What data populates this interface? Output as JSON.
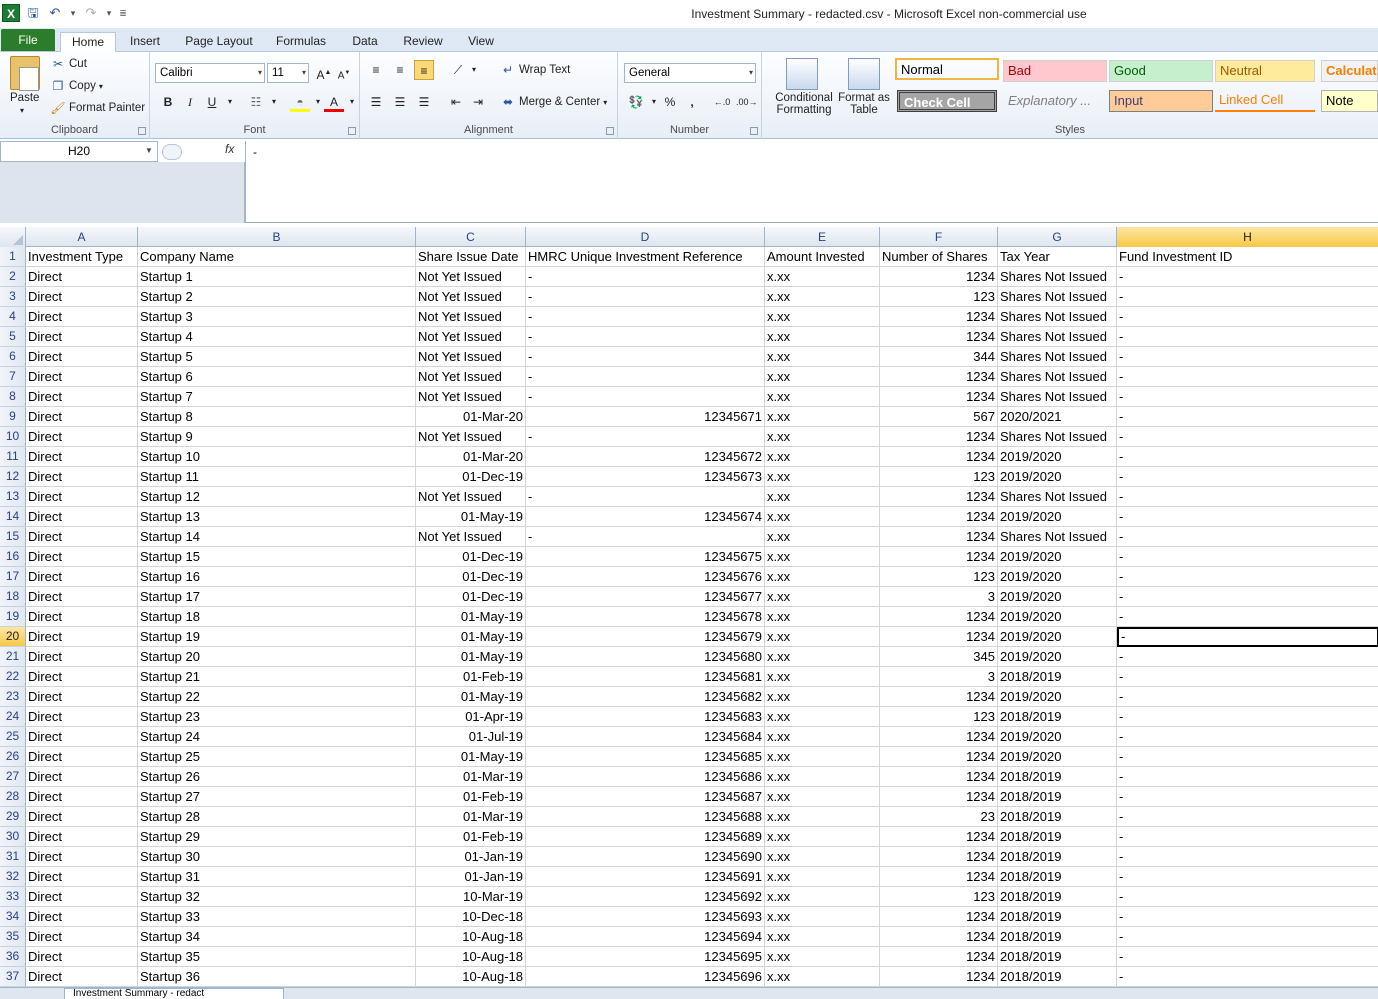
{
  "window": {
    "title": "Investment Summary - redacted.csv  -  Microsoft Excel non-commercial use"
  },
  "qat": {
    "logo": "X"
  },
  "tabs": [
    "File",
    "Home",
    "Insert",
    "Page Layout",
    "Formulas",
    "Data",
    "Review",
    "View"
  ],
  "ribbon": {
    "clipboard": {
      "label": "Clipboard",
      "paste": "Paste",
      "cut": "Cut",
      "copy": "Copy",
      "format_painter": "Format Painter"
    },
    "font": {
      "label": "Font",
      "name": "Calibri",
      "size": "11"
    },
    "alignment": {
      "label": "Alignment",
      "wrap_text": "Wrap Text",
      "merge_center": "Merge & Center"
    },
    "number": {
      "label": "Number",
      "format": "General",
      "percent": "%",
      "comma": ","
    },
    "styles": {
      "label": "Styles",
      "conditional": "Conditional Formatting",
      "format_table": "Format as Table",
      "cells": [
        {
          "name": "Normal",
          "bg": "#ffffff",
          "fg": "#000000"
        },
        {
          "name": "Bad",
          "bg": "#ffc7ce",
          "fg": "#9c0006"
        },
        {
          "name": "Good",
          "bg": "#c6efce",
          "fg": "#006100"
        },
        {
          "name": "Neutral",
          "bg": "#ffeb9c",
          "fg": "#9c5700"
        },
        {
          "name": "Calculati",
          "bg": "#f2f2f2",
          "fg": "#fa7d00"
        },
        {
          "name": "Check Cell",
          "bg": "#a5a5a5",
          "fg": "#ffffff"
        },
        {
          "name": "Explanatory ...",
          "bg": "#ffffff",
          "fg": "#7f7f7f"
        },
        {
          "name": "Input",
          "bg": "#ffcc99",
          "fg": "#3f3f76"
        },
        {
          "name": "Linked Cell",
          "bg": "#ffffff",
          "fg": "#fa7d00"
        },
        {
          "name": "Note",
          "bg": "#ffffcc",
          "fg": "#000000"
        }
      ]
    }
  },
  "formula_bar": {
    "name_box": "H20",
    "fx": "fx",
    "content": "-"
  },
  "columns": [
    "A",
    "B",
    "C",
    "D",
    "E",
    "F",
    "G",
    "H"
  ],
  "selected_column": "H",
  "selected_row": 20,
  "headers": [
    "Investment Type",
    "Company Name",
    "Share Issue Date",
    "HMRC Unique Investment Reference",
    "Amount Invested",
    "Number of Shares",
    "Tax Year",
    "Fund Investment ID"
  ],
  "rows": [
    [
      "Direct",
      "Startup 1",
      "Not Yet Issued",
      "-",
      "x.xx",
      "1234",
      "Shares Not Issued",
      "-"
    ],
    [
      "Direct",
      "Startup 2",
      "Not Yet Issued",
      "-",
      "x.xx",
      "123",
      "Shares Not Issued",
      "-"
    ],
    [
      "Direct",
      "Startup 3",
      "Not Yet Issued",
      "-",
      "x.xx",
      "1234",
      "Shares Not Issued",
      "-"
    ],
    [
      "Direct",
      "Startup 4",
      "Not Yet Issued",
      "-",
      "x.xx",
      "1234",
      "Shares Not Issued",
      "-"
    ],
    [
      "Direct",
      "Startup 5",
      "Not Yet Issued",
      "-",
      "x.xx",
      "344",
      "Shares Not Issued",
      "-"
    ],
    [
      "Direct",
      "Startup 6",
      "Not Yet Issued",
      "-",
      "x.xx",
      "1234",
      "Shares Not Issued",
      "-"
    ],
    [
      "Direct",
      "Startup 7",
      "Not Yet Issued",
      "-",
      "x.xx",
      "1234",
      "Shares Not Issued",
      "-"
    ],
    [
      "Direct",
      "Startup 8",
      "01-Mar-20",
      "12345671",
      "x.xx",
      "567",
      "2020/2021",
      "-"
    ],
    [
      "Direct",
      "Startup 9",
      "Not Yet Issued",
      "-",
      "x.xx",
      "1234",
      "Shares Not Issued",
      "-"
    ],
    [
      "Direct",
      "Startup 10",
      "01-Mar-20",
      "12345672",
      "x.xx",
      "1234",
      "2019/2020",
      "-"
    ],
    [
      "Direct",
      "Startup 11",
      "01-Dec-19",
      "12345673",
      "x.xx",
      "123",
      "2019/2020",
      "-"
    ],
    [
      "Direct",
      "Startup 12",
      "Not Yet Issued",
      "-",
      "x.xx",
      "1234",
      "Shares Not Issued",
      "-"
    ],
    [
      "Direct",
      "Startup 13",
      "01-May-19",
      "12345674",
      "x.xx",
      "1234",
      "2019/2020",
      "-"
    ],
    [
      "Direct",
      "Startup 14",
      "Not Yet Issued",
      "-",
      "x.xx",
      "1234",
      "Shares Not Issued",
      "-"
    ],
    [
      "Direct",
      "Startup 15",
      "01-Dec-19",
      "12345675",
      "x.xx",
      "1234",
      "2019/2020",
      "-"
    ],
    [
      "Direct",
      "Startup 16",
      "01-Dec-19",
      "12345676",
      "x.xx",
      "123",
      "2019/2020",
      "-"
    ],
    [
      "Direct",
      "Startup 17",
      "01-Dec-19",
      "12345677",
      "x.xx",
      "3",
      "2019/2020",
      "-"
    ],
    [
      "Direct",
      "Startup 18",
      "01-May-19",
      "12345678",
      "x.xx",
      "1234",
      "2019/2020",
      "-"
    ],
    [
      "Direct",
      "Startup 19",
      "01-May-19",
      "12345679",
      "x.xx",
      "1234",
      "2019/2020",
      "-"
    ],
    [
      "Direct",
      "Startup 20",
      "01-May-19",
      "12345680",
      "x.xx",
      "345",
      "2019/2020",
      "-"
    ],
    [
      "Direct",
      "Startup 21",
      "01-Feb-19",
      "12345681",
      "x.xx",
      "3",
      "2018/2019",
      "-"
    ],
    [
      "Direct",
      "Startup 22",
      "01-May-19",
      "12345682",
      "x.xx",
      "1234",
      "2019/2020",
      "-"
    ],
    [
      "Direct",
      "Startup 23",
      "01-Apr-19",
      "12345683",
      "x.xx",
      "123",
      "2018/2019",
      "-"
    ],
    [
      "Direct",
      "Startup 24",
      "01-Jul-19",
      "12345684",
      "x.xx",
      "1234",
      "2019/2020",
      "-"
    ],
    [
      "Direct",
      "Startup 25",
      "01-May-19",
      "12345685",
      "x.xx",
      "1234",
      "2019/2020",
      "-"
    ],
    [
      "Direct",
      "Startup 26",
      "01-Mar-19",
      "12345686",
      "x.xx",
      "1234",
      "2018/2019",
      "-"
    ],
    [
      "Direct",
      "Startup 27",
      "01-Feb-19",
      "12345687",
      "x.xx",
      "1234",
      "2018/2019",
      "-"
    ],
    [
      "Direct",
      "Startup 28",
      "01-Mar-19",
      "12345688",
      "x.xx",
      "23",
      "2018/2019",
      "-"
    ],
    [
      "Direct",
      "Startup 29",
      "01-Feb-19",
      "12345689",
      "x.xx",
      "1234",
      "2018/2019",
      "-"
    ],
    [
      "Direct",
      "Startup 30",
      "01-Jan-19",
      "12345690",
      "x.xx",
      "1234",
      "2018/2019",
      "-"
    ],
    [
      "Direct",
      "Startup 31",
      "01-Jan-19",
      "12345691",
      "x.xx",
      "1234",
      "2018/2019",
      "-"
    ],
    [
      "Direct",
      "Startup 32",
      "10-Mar-19",
      "12345692",
      "x.xx",
      "123",
      "2018/2019",
      "-"
    ],
    [
      "Direct",
      "Startup 33",
      "10-Dec-18",
      "12345693",
      "x.xx",
      "1234",
      "2018/2019",
      "-"
    ],
    [
      "Direct",
      "Startup 34",
      "10-Aug-18",
      "12345694",
      "x.xx",
      "1234",
      "2018/2019",
      "-"
    ],
    [
      "Direct",
      "Startup 35",
      "10-Aug-18",
      "12345695",
      "x.xx",
      "1234",
      "2018/2019",
      "-"
    ],
    [
      "Direct",
      "Startup 36",
      "10-Aug-18",
      "12345696",
      "x.xx",
      "1234",
      "2018/2019",
      "-"
    ]
  ],
  "sheet_tab": "Investment Summary - redact"
}
